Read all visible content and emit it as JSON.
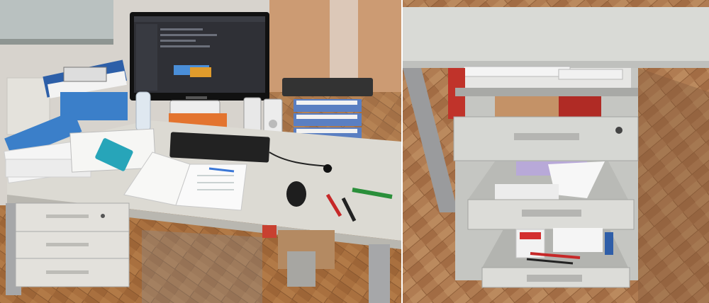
{
  "photos": [
    {
      "id": "left",
      "subject": "office-desk-overview",
      "colors": {
        "floor": "#a9703f",
        "desk_top": "#dcdad3",
        "monitor_screen": "#2f3036",
        "tray": "#5a7fc2",
        "binder": "#3b7fc9",
        "cabinet": "#dcdad6"
      }
    },
    {
      "id": "right",
      "subject": "open-pedestal-drawers",
      "colors": {
        "floor": "#b07c52",
        "desk_top": "#d9dad6",
        "drawer": "#d6d7d3",
        "red_box": "#c0332a"
      }
    }
  ]
}
